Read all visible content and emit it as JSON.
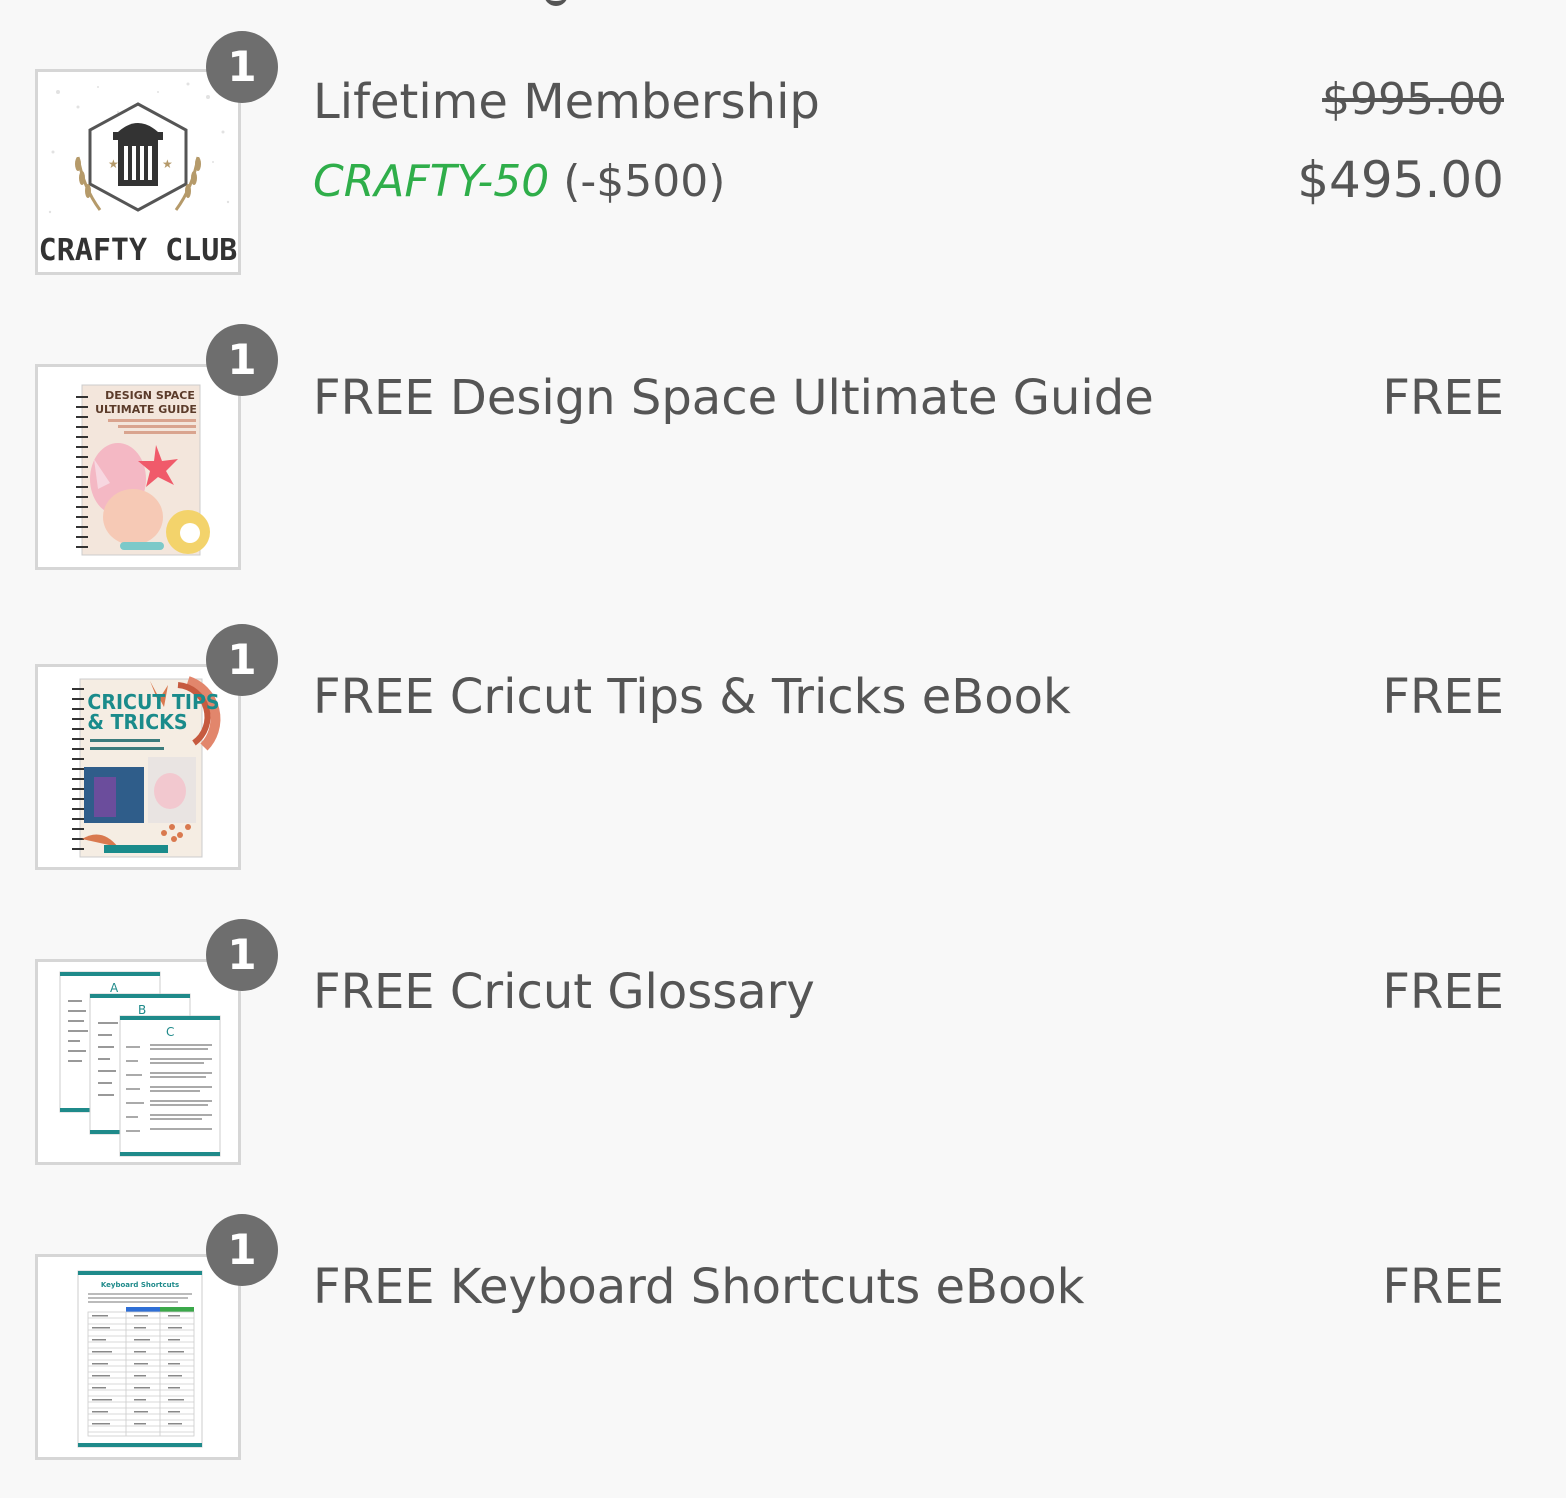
{
  "items": [
    {
      "name": "Lifetime Membership",
      "quantity": "1",
      "original_price": "$995.00",
      "price": "$495.00",
      "discount_code": "CRAFTY-50",
      "discount_amount": "(-$500)",
      "image_label": "CRAFTY CLUB"
    },
    {
      "name": "FREE Design Space Ultimate Guide",
      "quantity": "1",
      "price": "FREE",
      "image_label": "DESIGN SPACE ULTIMATE GUIDE"
    },
    {
      "name": "FREE Cricut Tips & Tricks eBook",
      "quantity": "1",
      "price": "FREE",
      "image_label": "CRICUT TIPS & TRICKS"
    },
    {
      "name": "FREE Cricut Glossary",
      "quantity": "1",
      "price": "FREE"
    },
    {
      "name": "FREE Keyboard Shortcuts eBook",
      "quantity": "1",
      "price": "FREE",
      "image_label": "Keyboard Shortcuts"
    }
  ],
  "colors": {
    "background": "#f8f8f8",
    "text": "#555555",
    "discount_code": "#2fae4a",
    "badge": "#6e6e6e"
  }
}
